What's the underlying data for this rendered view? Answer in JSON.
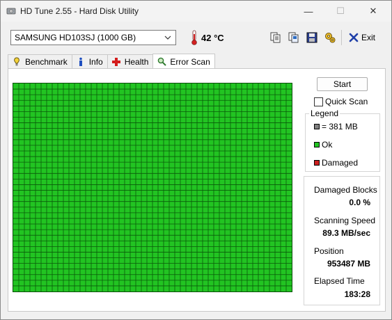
{
  "window": {
    "title": "HD Tune 2.55 - Hard Disk Utility",
    "minimize_glyph": "—",
    "maximize_glyph": "☐",
    "close_glyph": "✕"
  },
  "toolbar": {
    "drive": "SAMSUNG HD103SJ (1000 GB)",
    "temperature": "42 °C",
    "exit_label": "Exit",
    "icons": [
      "copy-info-icon",
      "copy-screen-icon",
      "save-icon",
      "options-icon",
      "exit-icon"
    ]
  },
  "tabs": [
    {
      "label": "Benchmark",
      "icon": "benchmark-icon"
    },
    {
      "label": "Info",
      "icon": "info-icon"
    },
    {
      "label": "Health",
      "icon": "health-icon"
    },
    {
      "label": "Error Scan",
      "icon": "magnifier-icon",
      "active": true
    }
  ],
  "scan": {
    "start_label": "Start",
    "quick_scan_label": "Quick Scan",
    "quick_scan_checked": false,
    "grid_cols": 50,
    "grid_rows": 37,
    "block_color_ok": "#22c422",
    "grid_line_color": "#0a5a0a"
  },
  "legend": {
    "title": "Legend",
    "items": [
      {
        "label": "= 381 MB",
        "color": "#808080"
      },
      {
        "label": "Ok",
        "color": "#22c422"
      },
      {
        "label": "Damaged",
        "color": "#cc1f1f"
      }
    ]
  },
  "stats": {
    "damaged_blocks_label": "Damaged Blocks",
    "damaged_blocks_value": "0.0 %",
    "scanning_speed_label": "Scanning Speed",
    "scanning_speed_value": "89.3 MB/sec",
    "position_label": "Position",
    "position_value": "953487 MB",
    "elapsed_label": "Elapsed Time",
    "elapsed_value": "183:28"
  }
}
